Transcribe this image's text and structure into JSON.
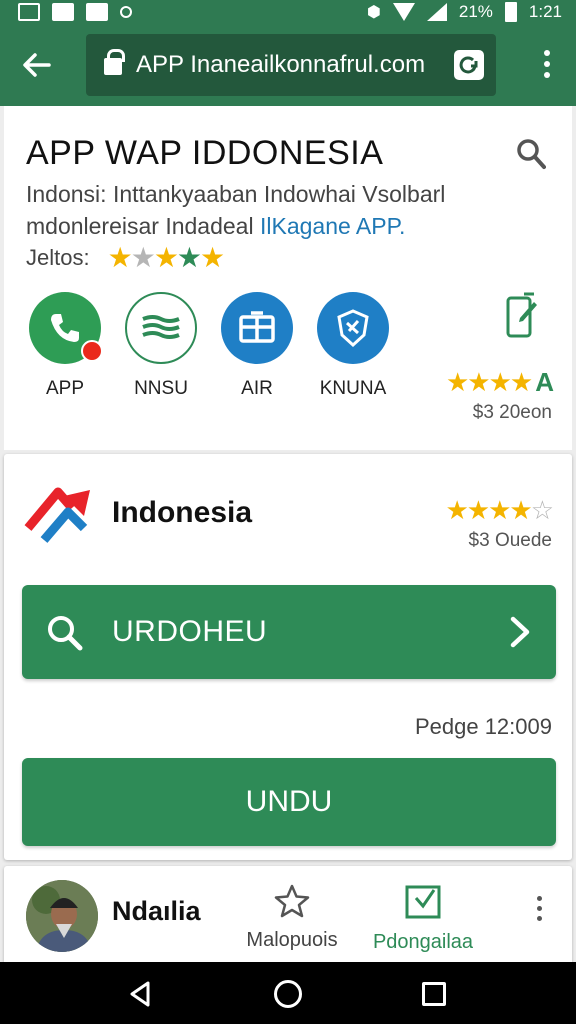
{
  "status_bar": {
    "battery_text": "21%",
    "time": "1:21"
  },
  "toolbar": {
    "url": "APP Inaneailkonnafrul.com"
  },
  "header": {
    "title": "APP WAP IDDONESIA",
    "description_line1": "Indonsi: Inttankyaaban Indowhai Vsolbarl",
    "description_line2_prefix": "mdonlereisar Indadeal ",
    "description_link": "IlKagane APP.",
    "rating_label": "Jeltos:",
    "rating_stars": 4
  },
  "apps": [
    {
      "label": "APP",
      "icon": "phone-icon"
    },
    {
      "label": "NNSU",
      "icon": "flag-icon"
    },
    {
      "label": "AIR",
      "icon": "building-icon"
    },
    {
      "label": "KNUNA",
      "icon": "shield-icon"
    }
  ],
  "side_rating": {
    "stars": 4,
    "price": "$3 20eon"
  },
  "featured": {
    "title": "Indonesia",
    "stars": 4,
    "price": "$3 Ouede",
    "search_button_label": "URDOHEU",
    "page_meta": "Pedge 12:009",
    "action_button_label": "UNDU"
  },
  "footer": {
    "user_name": "Ndaılia",
    "nav_a_label": "Malopuois",
    "nav_b_label": "Pdongailaa"
  },
  "colors": {
    "primary": "#2e8b57",
    "appbar": "#2f7a52",
    "star": "#f4b400",
    "link": "#1f78b4"
  }
}
